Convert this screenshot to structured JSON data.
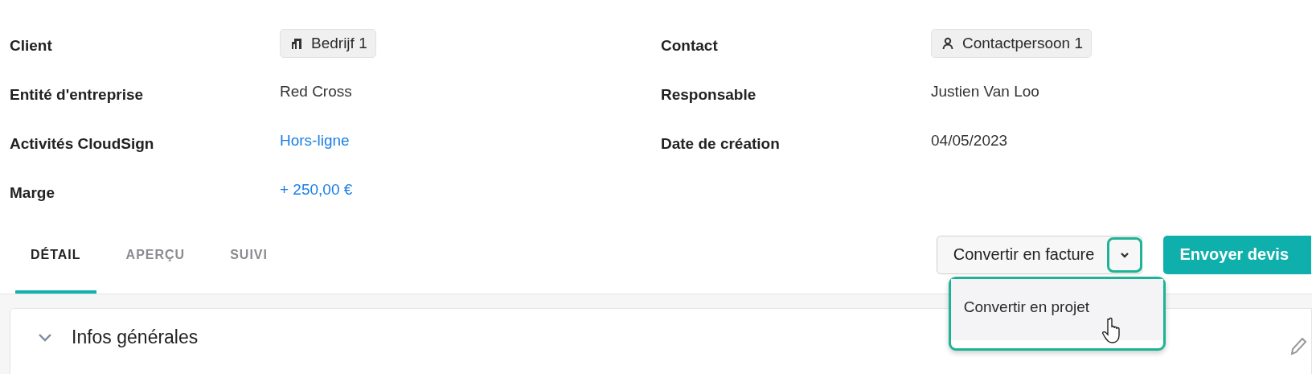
{
  "fields_left": [
    {
      "label": "Client",
      "value": "Bedrijf 1",
      "kind": "chip"
    },
    {
      "label": "Entité d'entreprise",
      "value": "Red Cross",
      "kind": "text"
    },
    {
      "label": "Activités CloudSign",
      "value": "Hors-ligne",
      "kind": "link"
    },
    {
      "label": "Marge",
      "value": "+ 250,00 €",
      "kind": "link"
    }
  ],
  "fields_right": [
    {
      "label": "Contact",
      "value": "Contactpersoon 1",
      "kind": "chip"
    },
    {
      "label": "Responsable",
      "value": "Justien Van Loo",
      "kind": "text"
    },
    {
      "label": "Date de création",
      "value": "04/05/2023",
      "kind": "text"
    }
  ],
  "tabs": [
    {
      "label": "DÉTAIL",
      "selected": true
    },
    {
      "label": "APERÇU",
      "selected": false
    },
    {
      "label": "SUIVI",
      "selected": false
    }
  ],
  "split_button": {
    "label": "Convertir en facture",
    "expanded": true
  },
  "primary_button": {
    "label": "Envoyer devis"
  },
  "menu": {
    "items": [
      {
        "label": "Convertir en projet"
      }
    ]
  },
  "section": {
    "title": "Infos générales",
    "expanded": true
  }
}
